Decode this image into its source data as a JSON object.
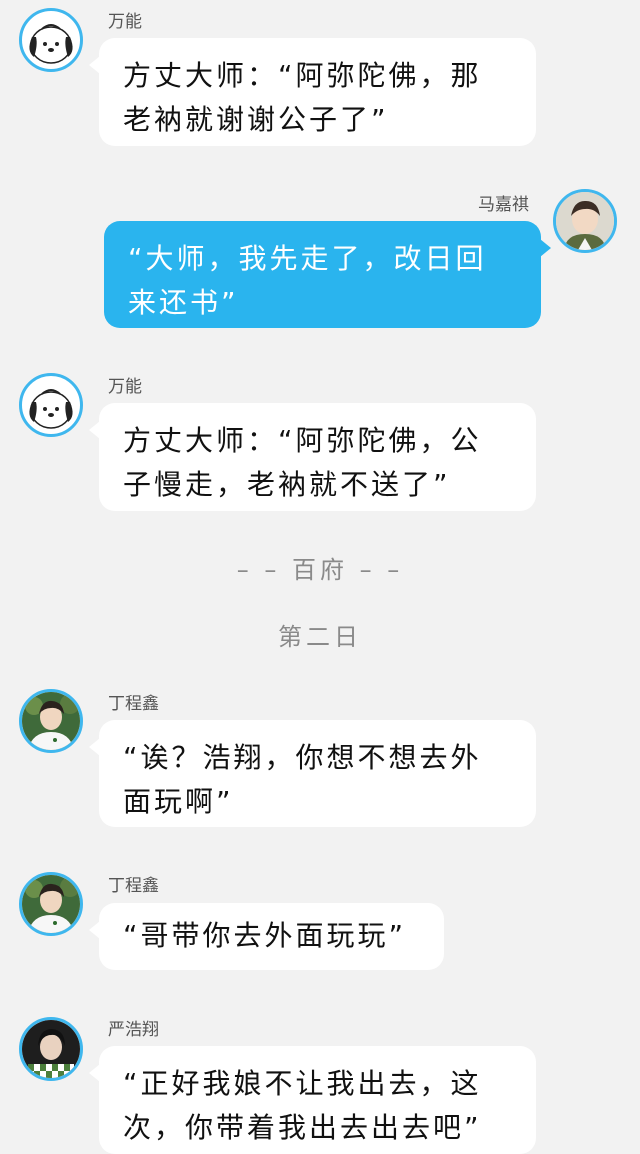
{
  "messages": [
    {
      "sender": "万能",
      "text": "方丈大师：“阿弥陀佛，那老衲就谢谢公子了”",
      "avatar": "cartoon-dog-avatar",
      "side": "left"
    },
    {
      "sender": "马嘉祺",
      "text": "“大师，我先走了，改日回来还书”",
      "avatar": "boy-photo-avatar",
      "side": "right"
    },
    {
      "sender": "万能",
      "text": "方丈大师：“阿弥陀佛，公子慢走，老衲就不送了”",
      "avatar": "cartoon-dog-avatar",
      "side": "left"
    },
    {
      "sender": "丁程鑫",
      "text": "“诶？浩翔，你想不想去外面玩啊”",
      "avatar": "boy-photo-avatar",
      "side": "left"
    },
    {
      "sender": "丁程鑫",
      "text": "“哥带你去外面玩玩”",
      "avatar": "boy-photo-avatar",
      "side": "left"
    },
    {
      "sender": "严浩翔",
      "text": "“正好我娘不让我出去，这次，你带着我出去出去吧”",
      "avatar": "boy-photo-avatar",
      "side": "left"
    }
  ],
  "system": {
    "scene": "– – 百府 – –",
    "day": "第二日"
  },
  "colors": {
    "background": "#f2f2f2",
    "bubble_self": "#2ab4ee",
    "bubble_other": "#ffffff",
    "avatar_ring": "#3fb7ee"
  }
}
